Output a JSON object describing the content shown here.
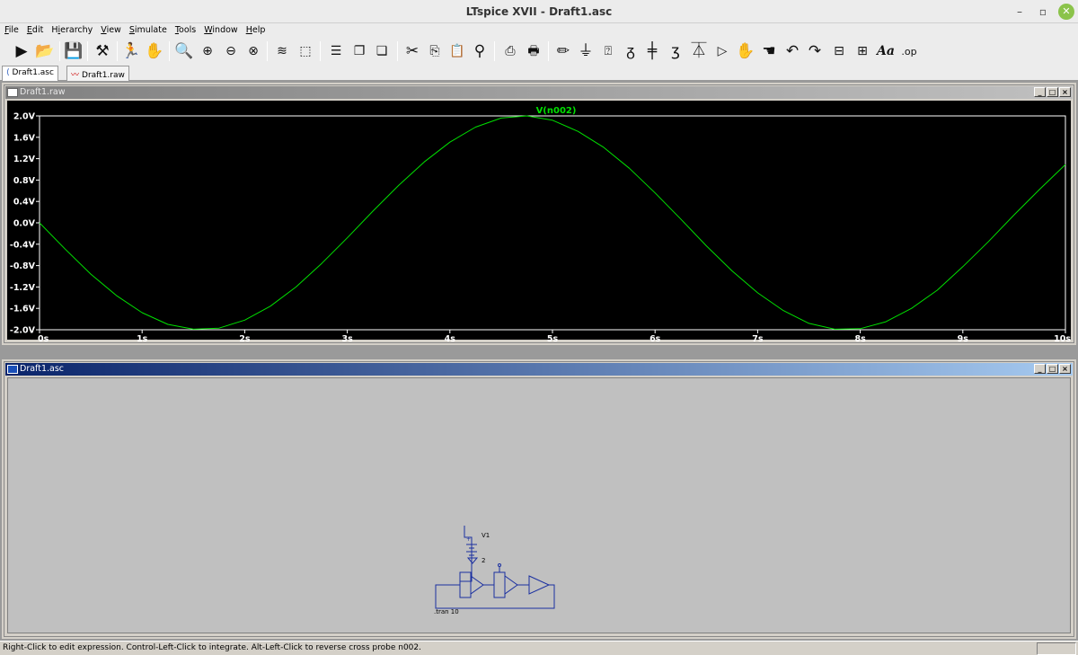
{
  "window": {
    "title": "LTspice XVII - Draft1.asc"
  },
  "menu": [
    {
      "pre": "",
      "key": "F",
      "post": "ile"
    },
    {
      "pre": "",
      "key": "E",
      "post": "dit"
    },
    {
      "pre": "H",
      "key": "i",
      "post": "erarchy"
    },
    {
      "pre": "",
      "key": "V",
      "post": "iew"
    },
    {
      "pre": "",
      "key": "S",
      "post": "imulate"
    },
    {
      "pre": "",
      "key": "T",
      "post": "ools"
    },
    {
      "pre": "",
      "key": "W",
      "post": "indow"
    },
    {
      "pre": "",
      "key": "H",
      "post": "elp"
    }
  ],
  "tabs": [
    {
      "label": "Draft1.asc",
      "icon": "schematic-icon"
    },
    {
      "label": "Draft1.raw",
      "icon": "waveform-icon"
    }
  ],
  "waveform_window": {
    "title": "Draft1.raw",
    "trace_label": "V(n002)"
  },
  "schematic_window": {
    "title": "Draft1.asc",
    "source_label": "V1",
    "source_value": "2",
    "directive": ".tran 10"
  },
  "status": {
    "message": "Right-Click to edit expression. Control-Left-Click to integrate. Alt-Left-Click to reverse cross probe n002."
  },
  "colors": {
    "trace": "#00e000",
    "grid_text": "#ffffff",
    "plot_bg": "#000000",
    "wire": "#1a2fa0"
  },
  "chart_data": {
    "type": "line",
    "title": "",
    "xlabel": "",
    "ylabel": "",
    "series": [
      {
        "name": "V(n002)",
        "x": [
          0,
          0.25,
          0.5,
          0.75,
          1,
          1.25,
          1.5,
          1.75,
          2,
          2.25,
          2.5,
          2.75,
          3,
          3.25,
          3.5,
          3.75,
          4,
          4.25,
          4.5,
          4.75,
          5,
          5.25,
          5.5,
          5.75,
          6,
          6.25,
          6.5,
          6.75,
          7,
          7.25,
          7.5,
          7.75,
          8,
          8.25,
          8.5,
          8.75,
          9,
          9.25,
          9.5,
          9.75,
          10
        ],
        "values": [
          0,
          -0.49,
          -0.96,
          -1.36,
          -1.68,
          -1.9,
          -1.99,
          -1.97,
          -1.82,
          -1.56,
          -1.2,
          -0.76,
          -0.28,
          0.22,
          0.7,
          1.14,
          1.51,
          1.79,
          1.96,
          2.0,
          1.92,
          1.71,
          1.41,
          1.02,
          0.56,
          0.07,
          -0.43,
          -0.9,
          -1.31,
          -1.64,
          -1.88,
          -1.99,
          -1.98,
          -1.85,
          -1.6,
          -1.26,
          -0.82,
          -0.35,
          0.15,
          0.63,
          1.09
        ]
      }
    ],
    "xlim": [
      0,
      10
    ],
    "ylim": [
      -2.0,
      2.0
    ],
    "x_ticks": [
      "0s",
      "1s",
      "2s",
      "3s",
      "4s",
      "5s",
      "6s",
      "7s",
      "8s",
      "9s",
      "10s"
    ],
    "y_ticks": [
      "2.0V",
      "1.6V",
      "1.2V",
      "0.8V",
      "0.4V",
      "0.0V",
      "-0.4V",
      "-0.8V",
      "-1.2V",
      "-1.6V",
      "-2.0V"
    ],
    "grid": false,
    "legend": "top-center"
  }
}
